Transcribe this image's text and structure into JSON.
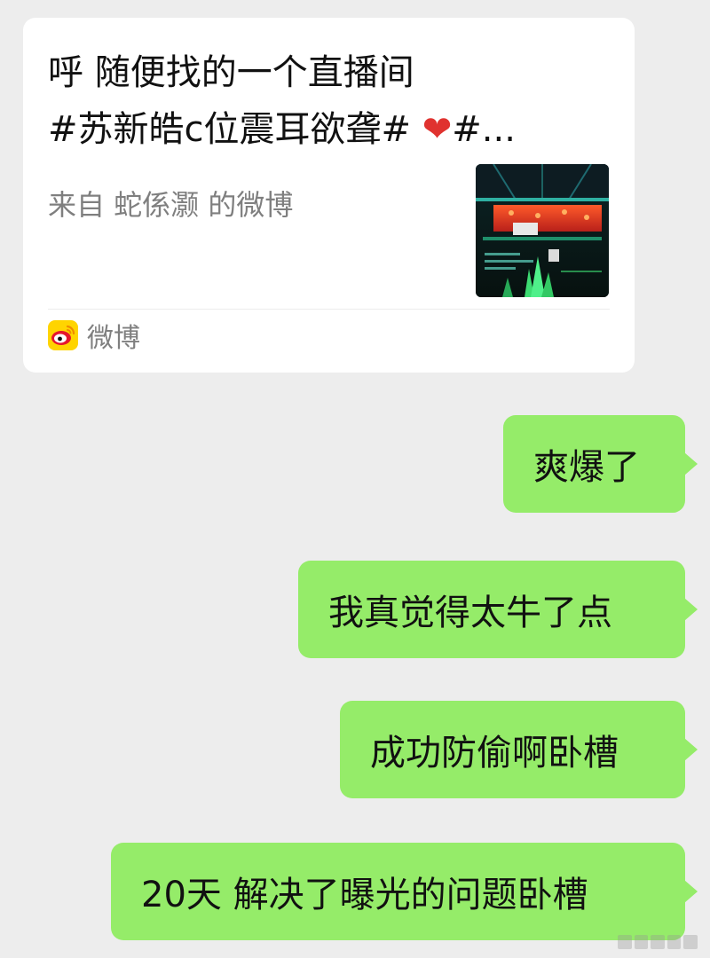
{
  "shared_card": {
    "title_line1": "呼 随便找的一个直播间",
    "title_line2_tag": "#苏新皓c位震耳欲聋#",
    "title_line2_emoji": "❤",
    "title_line2_suffix": "#...",
    "source": "来自 蛇係灏 的微博",
    "app_name": "微博",
    "thumbnail_icon": "live-stream-thumbnail",
    "app_icon": "weibo-icon"
  },
  "messages": [
    {
      "text": "爽爆了"
    },
    {
      "text": "我真觉得太牛了点"
    },
    {
      "text": "成功防偷啊卧槽"
    },
    {
      "text": "20天 解决了曝光的问题卧槽"
    }
  ],
  "colors": {
    "background": "#ededed",
    "incoming_bubble": "#ffffff",
    "outgoing_bubble": "#95ec69",
    "secondary_text": "#7f7f7f"
  }
}
